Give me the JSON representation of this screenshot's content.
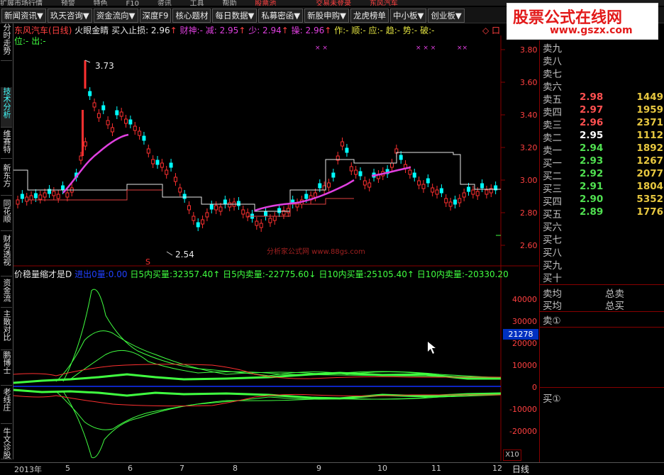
{
  "top_strip": [
    "扩展市场行情",
    "预警",
    "特色",
    "F10",
    "资讯",
    "工具",
    "帮助",
    "股票池",
    "交易未登录",
    "东风汽车"
  ],
  "menu": [
    "新闻资讯▼",
    "玖天咨询▼",
    "资金流向▼",
    "深度F9",
    "核心题材",
    "每日数据▼",
    "私募密函▼",
    "新股申购▼",
    "龙虎榜单",
    "中小板▼",
    "创业板▼"
  ],
  "logo": {
    "title": "股票公式在线网",
    "url": "www.gszx.com"
  },
  "sidebar_tabs": [
    "分时走势",
    "技术分析",
    "维赛特",
    "新东方",
    "同花顺",
    "财务透视",
    "资金流",
    "主散对比",
    "鹏博士",
    "老线庄",
    "牛文诊股"
  ],
  "main_info": {
    "stock_name": "东风汽车",
    "period": "(日线)",
    "indicator": "火眼金睛",
    "stop_label": "买入止损: 2.96",
    "caishen": "财神:-",
    "jian": "减: 2.95",
    "shao": "少: 2.94",
    "cao": "操: 2.96",
    "flags": "作:- 顺:- 应:- 趋:- 势:- 破:-",
    "line2": "位:- 出:-",
    "tag": "◇ 口"
  },
  "price_axis": [
    "3.80",
    "3.60",
    "3.40",
    "3.20",
    "3.00",
    "2.80",
    "2.60"
  ],
  "annotations": {
    "high": "3.73",
    "low": "2.54",
    "watermark": "分析家公式网 www.88gs.com",
    "red_s": "S"
  },
  "panel2": {
    "name": "价稳量缩才是D",
    "i1_label": "进出0量:",
    "i1_value": "0.00",
    "i2_label": "日5内买量:",
    "i2_value": "32357.40↑",
    "i3_label": "日5内卖量:",
    "i3_value": "-22775.60↓",
    "i4_label": "日10内买量:",
    "i4_value": "25105.40↑",
    "i5_label": "日10内卖量:",
    "i5_value": "-20330.20"
  },
  "volume_axis": [
    "40000",
    "30000",
    "20000",
    "10000",
    "0",
    "-10000",
    "-20000"
  ],
  "volume_highlight": "21278",
  "x10": "X10",
  "quote": {
    "sells_empty": [
      "卖九",
      "卖八",
      "卖七",
      "卖六"
    ],
    "sells": [
      {
        "label": "卖五",
        "price": "2.98",
        "vol": "1449",
        "color": "#ff5050"
      },
      {
        "label": "卖四",
        "price": "2.97",
        "vol": "1959",
        "color": "#ff5050"
      },
      {
        "label": "卖三",
        "price": "2.96",
        "vol": "2371",
        "color": "#ff5050"
      },
      {
        "label": "卖二",
        "price": "2.95",
        "vol": "1112",
        "color": "#ffffff"
      },
      {
        "label": "卖一",
        "price": "2.94",
        "vol": "1892",
        "color": "#50e050"
      }
    ],
    "buys": [
      {
        "label": "买一",
        "price": "2.93",
        "vol": "1267",
        "color": "#50e050"
      },
      {
        "label": "买二",
        "price": "2.92",
        "vol": "2077",
        "color": "#50e050"
      },
      {
        "label": "买三",
        "price": "2.91",
        "vol": "1804",
        "color": "#50e050"
      },
      {
        "label": "买四",
        "price": "2.90",
        "vol": "5352",
        "color": "#50e050"
      },
      {
        "label": "买五",
        "price": "2.89",
        "vol": "1776",
        "color": "#50e050"
      }
    ],
    "buys_empty": [
      "买六",
      "买七",
      "买八",
      "买九",
      "买十"
    ],
    "avg_sell": "卖均",
    "avg_buy": "买均",
    "total_sell": "总卖",
    "total_buy": "总买",
    "sell_marker": "卖①",
    "buy_marker": "买①"
  },
  "x_axis": [
    "2013年",
    "5",
    "6",
    "7",
    "8",
    "9",
    "10",
    "11",
    "12"
  ],
  "period_label": "日线",
  "colors": {
    "up": "#ff3030",
    "down": "#00ffff",
    "ma": "#e040e0",
    "vol_green": "#40ff40",
    "vol_red": "#ff3030"
  }
}
